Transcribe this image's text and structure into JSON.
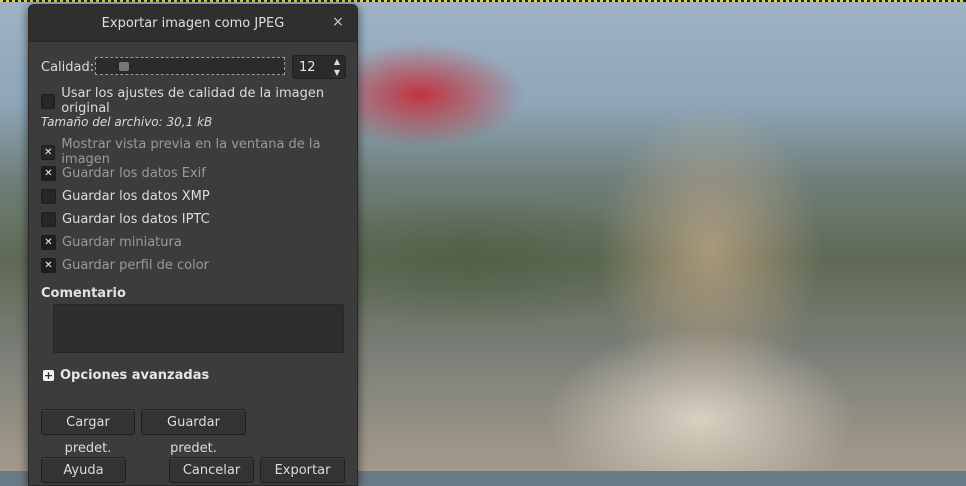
{
  "dialog": {
    "title": "Exportar imagen como JPEG",
    "close_glyph": "×"
  },
  "quality": {
    "label": "Calidad:",
    "value": "12",
    "slider_fraction": 0.12
  },
  "use_original_quality": {
    "label": "Usar los ajustes de calidad de la imagen original",
    "checked": false
  },
  "file_size": "Tamaño del archivo: 30,1 kB",
  "show_preview": {
    "label": "Mostrar vista previa en la ventana de la imagen",
    "checked": true
  },
  "options": [
    {
      "label": "Guardar los datos Exif",
      "checked": true,
      "dim": true
    },
    {
      "label": "Guardar los datos XMP",
      "checked": false,
      "dim": false
    },
    {
      "label": "Guardar los datos IPTC",
      "checked": false,
      "dim": false
    },
    {
      "label": "Guardar miniatura",
      "checked": true,
      "dim": true
    },
    {
      "label": "Guardar perfil de color",
      "checked": true,
      "dim": true
    }
  ],
  "comment": {
    "title": "Comentario",
    "value": ""
  },
  "advanced": {
    "label": "Opciones avanzadas",
    "icon": "plus-icon"
  },
  "buttons": {
    "load_defaults": "Cargar predet.",
    "save_defaults": "Guardar predet.",
    "help": "Ayuda",
    "cancel": "Cancelar",
    "export": "Exportar"
  }
}
